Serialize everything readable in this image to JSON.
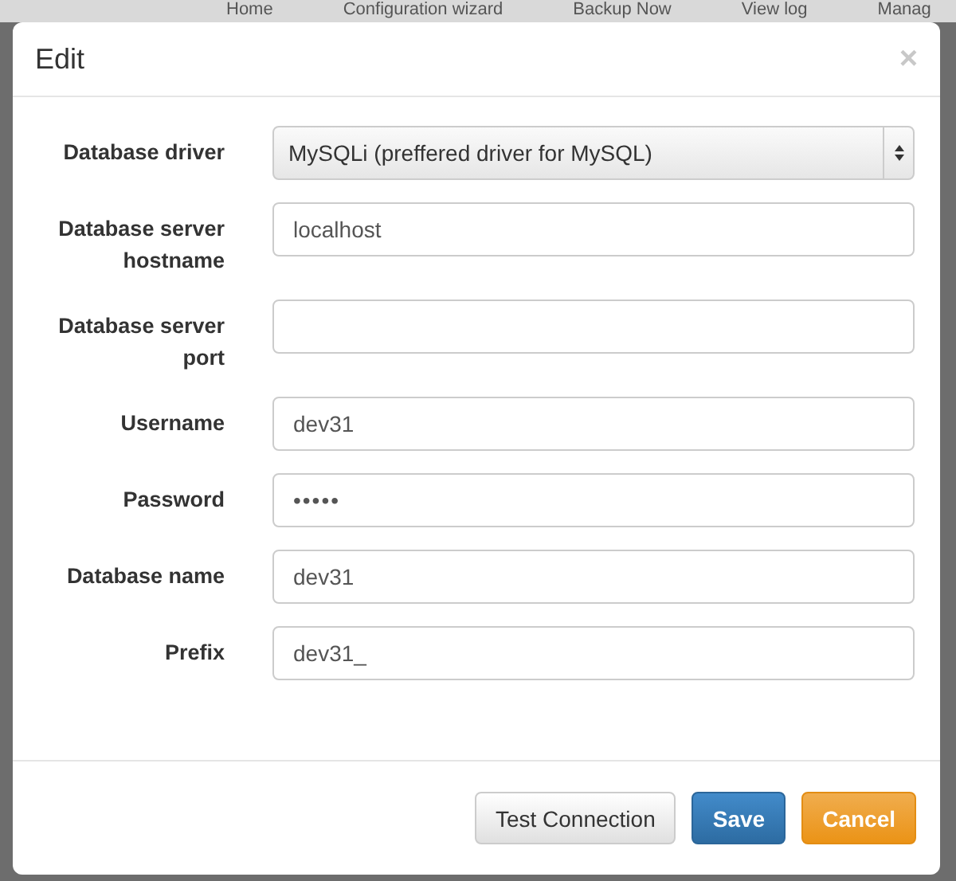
{
  "background_nav": [
    "Home",
    "Configuration wizard",
    "Backup Now",
    "View log",
    "Manag"
  ],
  "dialog": {
    "title": "Edit",
    "close": "×"
  },
  "fields": [
    {
      "label": "Database driver",
      "kind": "select",
      "value": "MySQLi (preffered driver for MySQL)"
    },
    {
      "label": "Database server hostname",
      "kind": "text",
      "value": "localhost"
    },
    {
      "label": "Database server port",
      "kind": "text"
    },
    {
      "label": "Username",
      "kind": "text",
      "value": "dev31"
    },
    {
      "label": "Password",
      "kind": "password",
      "value": "•••••"
    },
    {
      "label": "Database name",
      "kind": "text",
      "value": "dev31"
    },
    {
      "label": "Prefix",
      "kind": "text",
      "value": "dev31_"
    }
  ],
  "buttons": [
    {
      "label": "Test Connection",
      "kind": "default"
    },
    {
      "label": "Save",
      "kind": "primary"
    },
    {
      "label": "Cancel",
      "kind": "warning"
    }
  ]
}
